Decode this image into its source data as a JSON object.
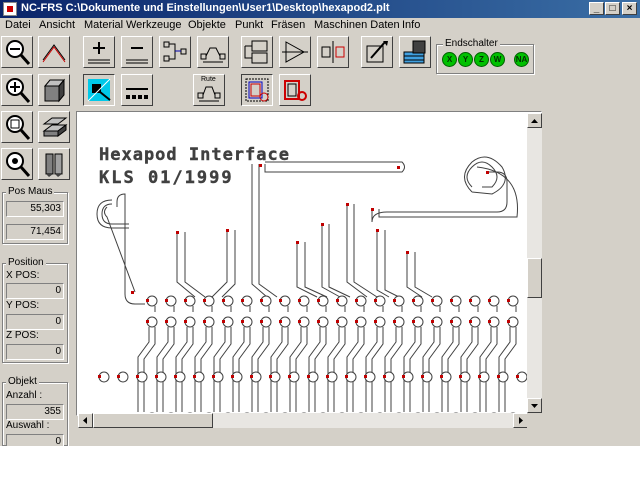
{
  "window": {
    "title": "NC-FRS C:\\Dokumente und Einstellungen\\User1\\Desktop\\hexapod2.plt",
    "controls": {
      "minimize": "_",
      "maximize": "□",
      "close": "×"
    }
  },
  "menu": [
    "Datei",
    "Ansicht",
    "Material",
    "Werkzeuge",
    "Objekte",
    "Punkt",
    "Fräsen",
    "Maschinen Daten",
    "Info"
  ],
  "toolbar": {
    "route_label": "Rute"
  },
  "endschalter": {
    "label": "Endschalter",
    "leds": [
      "X",
      "Y",
      "Z",
      "W",
      "NA"
    ],
    "color": "#00c000"
  },
  "pos_maus": {
    "label": "Pos Maus",
    "x": "55,303",
    "y": "71,454"
  },
  "position": {
    "label": "Position",
    "x_label": "X POS:",
    "x_value": "0",
    "y_label": "Y POS:",
    "y_value": "0",
    "z_label": "Z POS:",
    "z_value": "0"
  },
  "objekt": {
    "label": "Objekt",
    "anzahl_label": "Anzahl :",
    "anzahl_value": "355",
    "auswahl_label": "Auswahl :",
    "auswahl_value": "0"
  },
  "canvas": {
    "text_line1": "Hexapod Interface",
    "text_line2": "KLS 01/1999",
    "trace_color": "#404040",
    "pad_color": "#c00000"
  }
}
